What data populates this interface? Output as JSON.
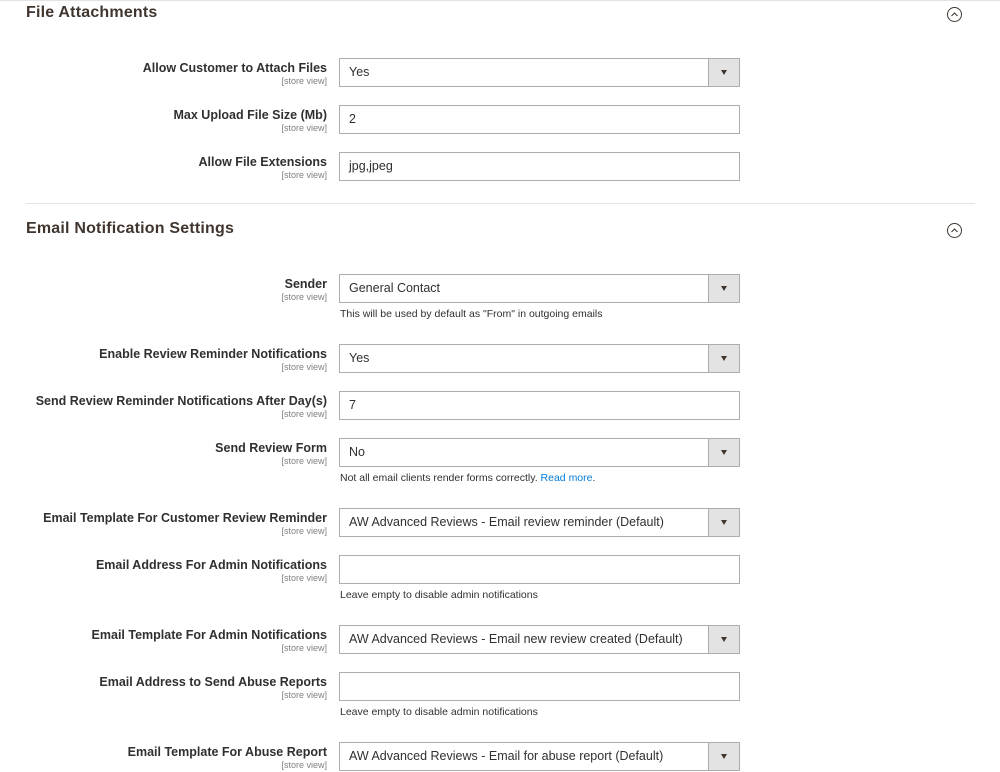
{
  "file_attachments": {
    "title": "File Attachments",
    "fields": [
      {
        "label": "Allow Customer to Attach Files",
        "scope": "[store view]",
        "value": "Yes",
        "type": "select"
      },
      {
        "label": "Max Upload File Size (Mb)",
        "scope": "[store view]",
        "value": "2",
        "type": "text"
      },
      {
        "label": "Allow File Extensions",
        "scope": "[store view]",
        "value": "jpg,jpeg",
        "type": "text"
      }
    ]
  },
  "email_notifications": {
    "title": "Email Notification Settings",
    "fields": [
      {
        "label": "Sender",
        "scope": "[store view]",
        "value": "General Contact",
        "type": "select",
        "note": "This will be used by default as \"From\" in outgoing emails"
      },
      {
        "label": "Enable Review Reminder Notifications",
        "scope": "[store view]",
        "value": "Yes",
        "type": "select"
      },
      {
        "label": "Send Review Reminder Notifications After Day(s)",
        "scope": "[store view]",
        "value": "7",
        "type": "text"
      },
      {
        "label": "Send Review Form",
        "scope": "[store view]",
        "value": "No",
        "type": "select",
        "note": "Not all email clients render forms correctly.",
        "note_link": "Read more",
        "note_suffix": "."
      },
      {
        "label": "Email Template For Customer Review Reminder",
        "scope": "[store view]",
        "value": "AW Advanced Reviews - Email review reminder (Default)",
        "type": "select"
      },
      {
        "label": "Email Address For Admin Notifications",
        "scope": "[store view]",
        "value": "",
        "type": "text",
        "note": "Leave empty to disable admin notifications"
      },
      {
        "label": "Email Template For Admin Notifications",
        "scope": "[store view]",
        "value": "AW Advanced Reviews - Email new review created (Default)",
        "type": "select"
      },
      {
        "label": "Email Address to Send Abuse Reports",
        "scope": "[store view]",
        "value": "",
        "type": "text",
        "note": "Leave empty to disable admin notifications"
      },
      {
        "label": "Email Template For Abuse Report",
        "scope": "[store view]",
        "value": "AW Advanced Reviews - Email for abuse report (Default)",
        "type": "select"
      }
    ]
  },
  "icons": {
    "collapse": "chevron-up-circle-icon",
    "select_arrow": "caret-down-icon"
  }
}
